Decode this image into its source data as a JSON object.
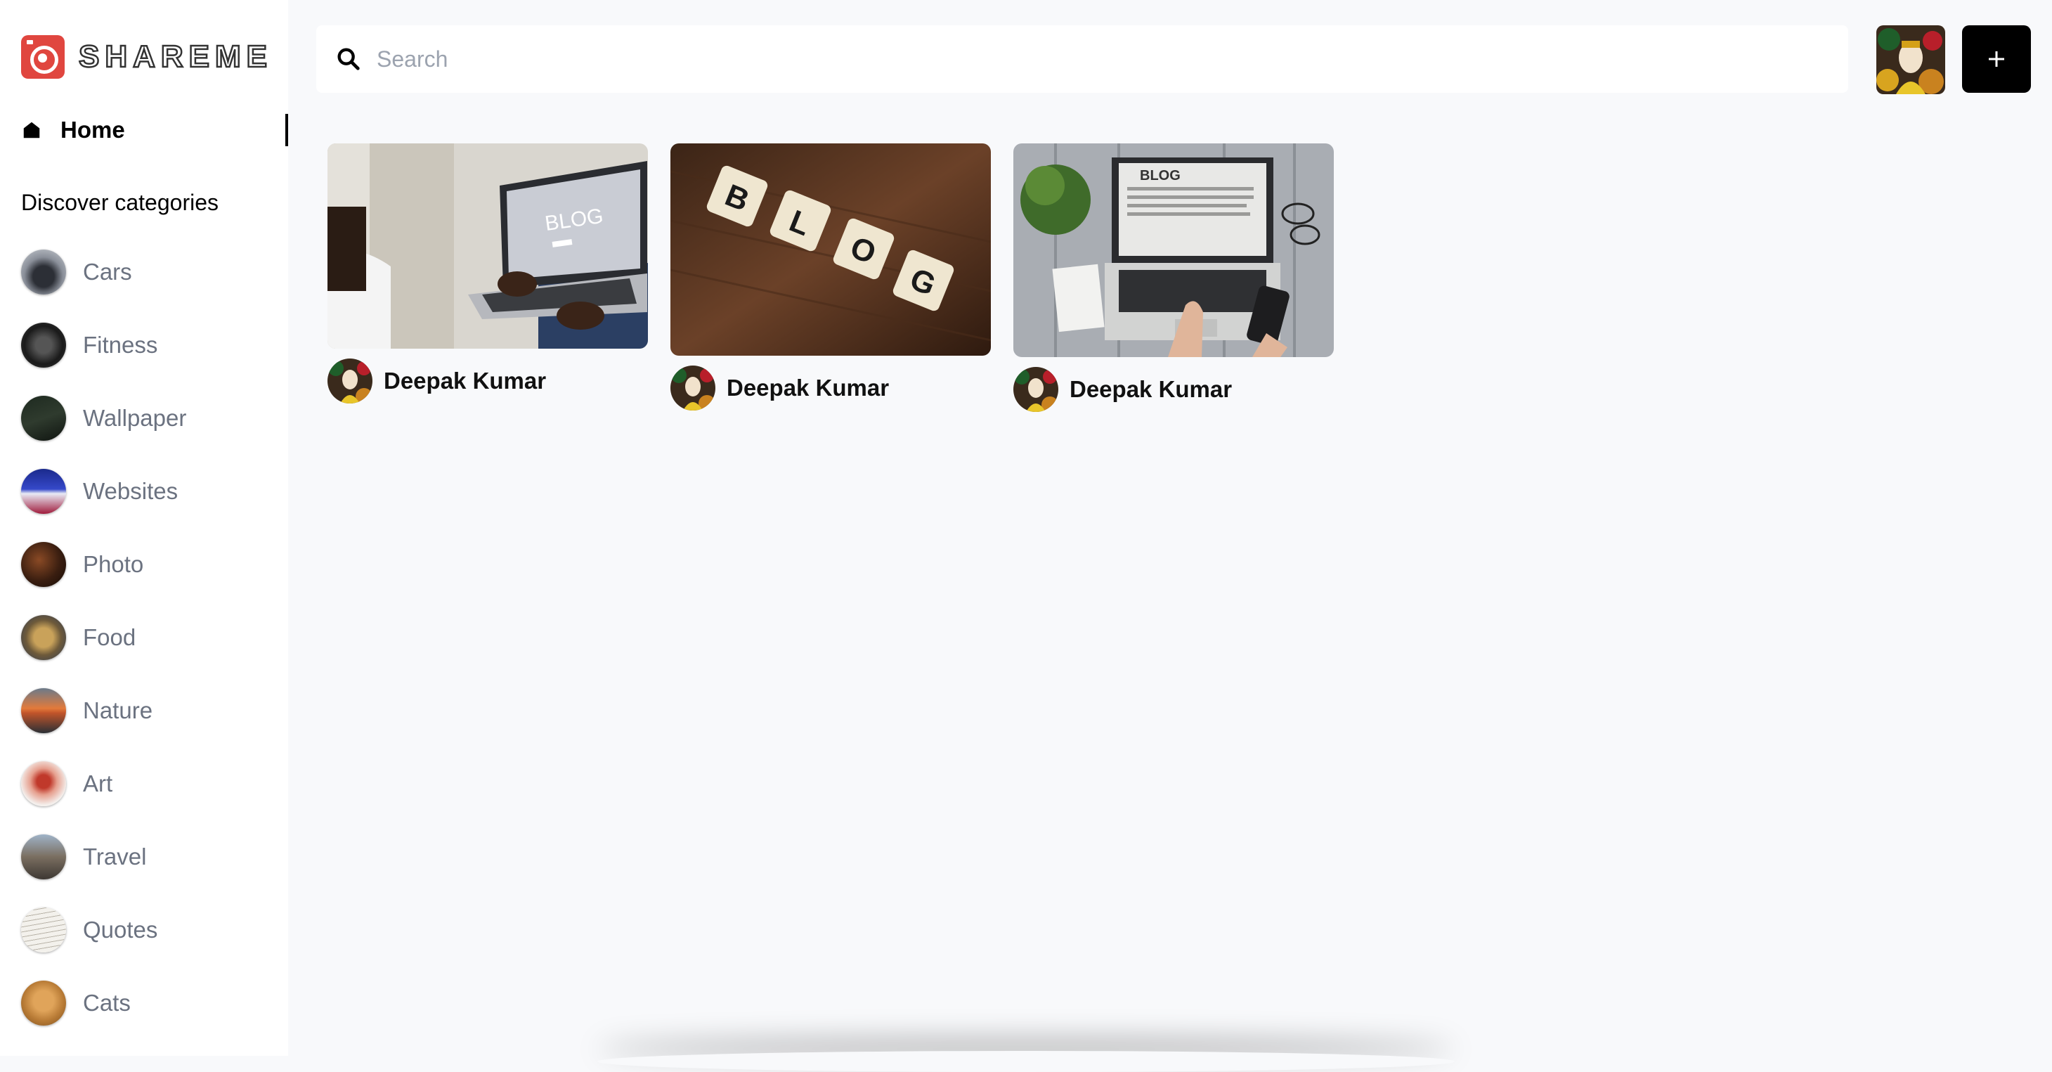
{
  "app": {
    "name": "SHAREME"
  },
  "search": {
    "placeholder": "Search",
    "value": ""
  },
  "nav": {
    "home_label": "Home"
  },
  "sidebar": {
    "discover_title": "Discover categories",
    "categories": [
      {
        "label": "Cars"
      },
      {
        "label": "Fitness"
      },
      {
        "label": "Wallpaper"
      },
      {
        "label": "Websites"
      },
      {
        "label": "Photo"
      },
      {
        "label": "Food"
      },
      {
        "label": "Nature"
      },
      {
        "label": "Art"
      },
      {
        "label": "Travel"
      },
      {
        "label": "Quotes"
      },
      {
        "label": "Cats"
      }
    ]
  },
  "header": {
    "add_label": "+"
  },
  "pins": [
    {
      "author": "Deepak Kumar",
      "image_text": "BLOG"
    },
    {
      "author": "Deepak Kumar",
      "image_text": "BLOG"
    },
    {
      "author": "Deepak Kumar",
      "image_text": "BLOG"
    }
  ],
  "colors": {
    "brand": "#e0463f",
    "background": "#f8f9fb",
    "muted_text": "#6b7280"
  }
}
